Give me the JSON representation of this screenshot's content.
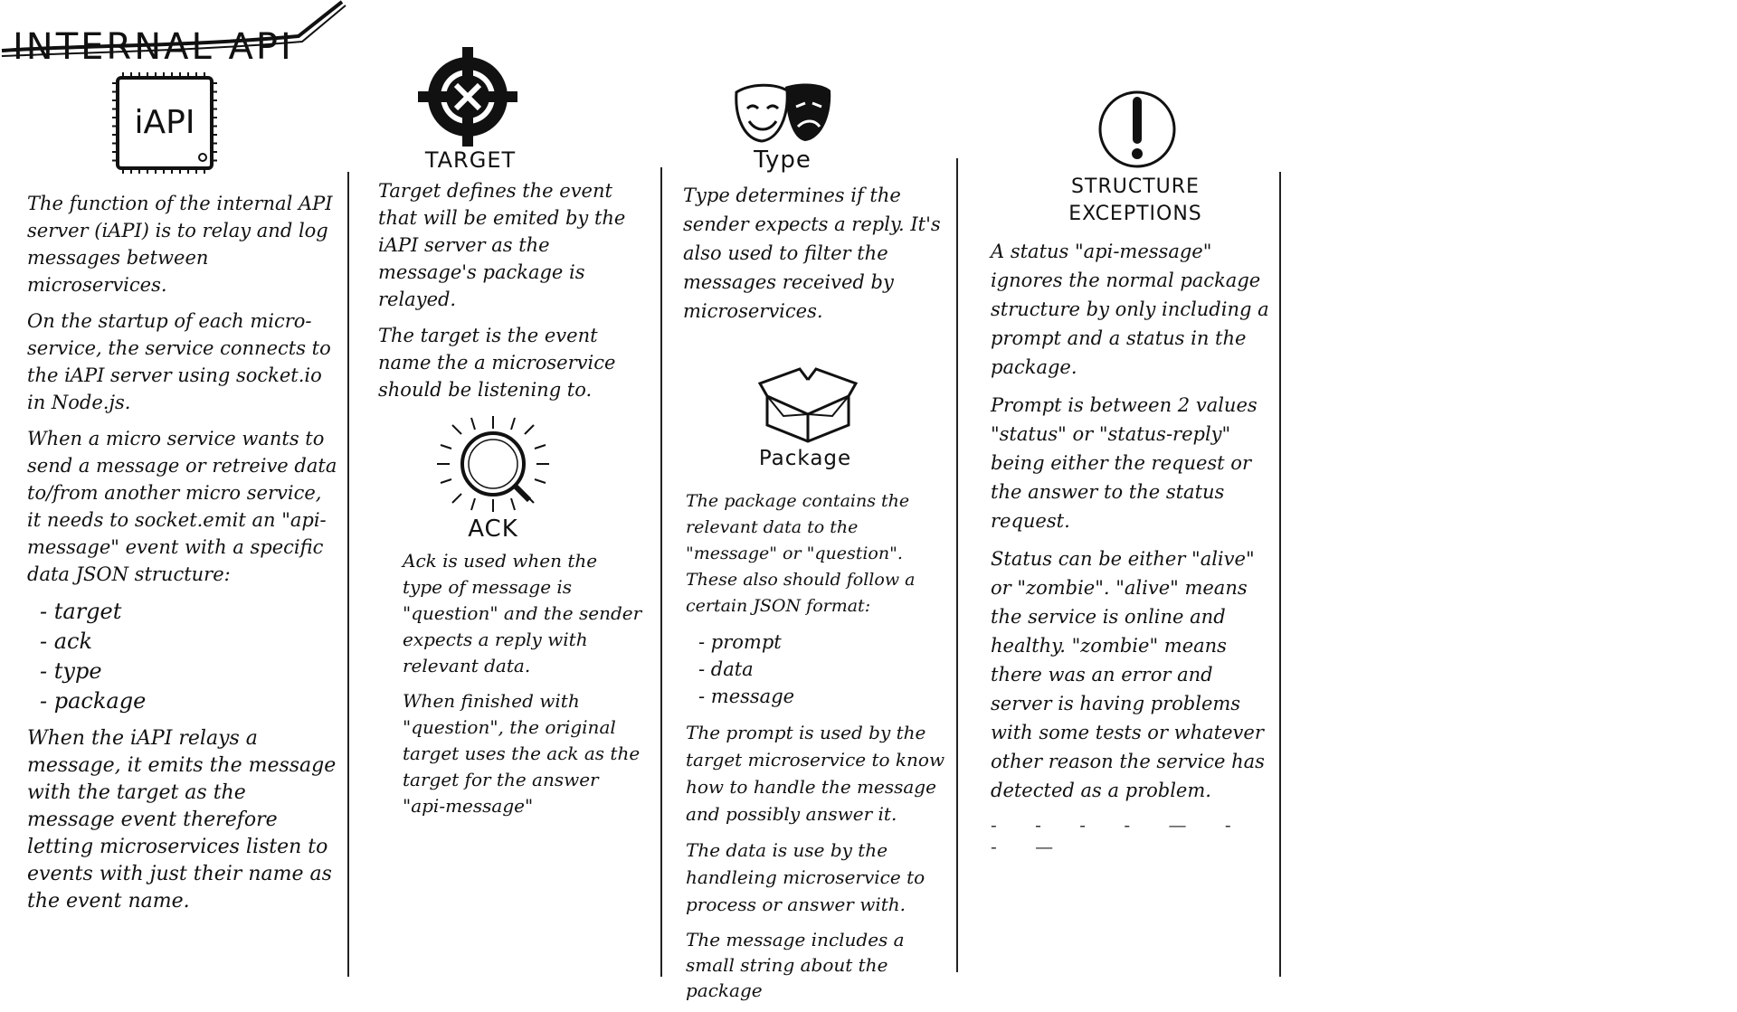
{
  "title": "INTERNAL API",
  "columns": [
    {
      "icon": "chip-icon",
      "icon_label": "iAPI",
      "paragraphs": [
        "The function of the internal API server (iAPI) is to relay and log messages between microservices.",
        "On the startup of each micro-service, the service connects to the iAPI server using socket.io in Node.js.",
        "When a micro service wants to send a message or retreive data to/from another micro service, it needs to socket.emit an \"api-message\" event with a specific data JSON structure:"
      ],
      "list": [
        "target",
        "ack",
        "type",
        "package"
      ],
      "closing": "When the iAPI relays a message, it emits the message with the target as the message event therefore letting microservices listen to events with just their name as the event name."
    },
    {
      "heading": "TARGET",
      "icon": "crosshair-icon",
      "paragraphs": [
        "Target defines the event that will be emited by the iAPI server as the message's package is relayed.",
        "The target is the event name the a microservice should be listening to."
      ],
      "sub_heading": "ACK",
      "sub_icon": "magnifier-icon",
      "sub_paragraphs": [
        "Ack is used when the type of message is \"question\" and the sender expects a reply with relevant data.",
        "When finished with \"question\", the original target uses the ack as the target for the answer \"api-message\""
      ]
    },
    {
      "heading": "Type",
      "icon": "theater-masks-icon",
      "paragraphs": [
        "Type determines if the sender expects a reply. It's also used to filter the messages received by microservices."
      ],
      "sub_heading": "Package",
      "sub_icon": "open-box-icon",
      "sub_paragraphs": [
        "The package contains the relevant data to the \"message\" or \"question\". These also should follow a certain JSON format:"
      ],
      "list": [
        "prompt",
        "data",
        "message"
      ],
      "closing_paragraphs": [
        "The prompt is used by the target microservice to know how to handle the message and possibly answer it.",
        "The data is use by the handleing microservice to process or answer with.",
        "The message includes a small string about the package"
      ]
    },
    {
      "heading": "STRUCTURE EXCEPTIONS",
      "icon": "exclamation-icon",
      "paragraphs": [
        "A status \"api-message\" ignores the normal package structure by only including a prompt and a status in the package.",
        "Prompt is between 2 values \"status\" or \"status-reply\" being either the request or the answer to the status request.",
        "Status can be either \"alive\" or \"zombie\". \"alive\" means the service is online and healthy. \"zombie\" means there was an error and server is having problems with some tests or whatever other reason the service has detected as a problem."
      ],
      "trailing": "- - - - — - - —"
    }
  ]
}
